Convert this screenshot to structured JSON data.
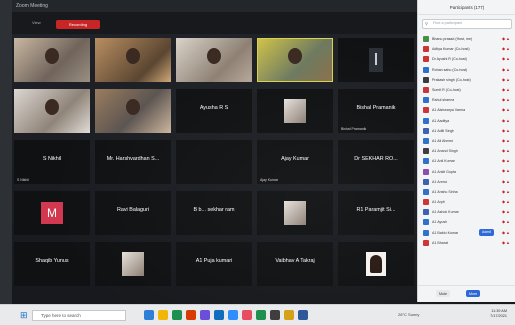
{
  "window": {
    "title": "Zoom Meeting",
    "recording_label": "Recording",
    "view_label": "View"
  },
  "grid": {
    "tiles": [
      {
        "name": "",
        "caption": "",
        "video": "video1"
      },
      {
        "name": "",
        "caption": "",
        "video": "video2"
      },
      {
        "name": "",
        "caption": "",
        "video": "video3"
      },
      {
        "name": "",
        "caption": "",
        "video": "video4",
        "speaking": true
      },
      {
        "name": "",
        "caption": "",
        "thumb": "portrait"
      },
      {
        "name": "",
        "caption": "",
        "video": "video5"
      },
      {
        "name": "",
        "caption": "",
        "video": "video6"
      },
      {
        "name": "Ayusha R S",
        "caption": ""
      },
      {
        "name": "",
        "caption": "",
        "thumb": "photo"
      },
      {
        "name": "Bishal Pramanik",
        "caption": "Bishal Pramanik"
      },
      {
        "name": "S Nikhil",
        "caption": "S Nikhil"
      },
      {
        "name": "Mr. Harshvardhan S...",
        "caption": ""
      },
      {
        "name": "",
        "caption": ""
      },
      {
        "name": "Ajay Kumar",
        "caption": "Ajay Kumar"
      },
      {
        "name": "Dr SEKHAR RO...",
        "caption": ""
      },
      {
        "name": "",
        "caption": "",
        "thumb": "m-avatar"
      },
      {
        "name": "Ravi Balaguri",
        "caption": ""
      },
      {
        "name": "B b... sekhar ram",
        "caption": ""
      },
      {
        "name": "",
        "caption": "",
        "thumb": "photo2"
      },
      {
        "name": "R1 Paramjit Si...",
        "caption": ""
      },
      {
        "name": "Shaqib Yunus",
        "caption": ""
      },
      {
        "name": "",
        "caption": "",
        "thumb": "photo3"
      },
      {
        "name": "A1 Puja kumari",
        "caption": ""
      },
      {
        "name": "Vaibhav A Takraj",
        "caption": ""
      },
      {
        "name": "",
        "caption": "",
        "thumb": "silhouette"
      }
    ]
  },
  "participants_panel": {
    "title": "Participants (177)",
    "search_placeholder": "Find a participant",
    "admit_label": "Admit",
    "mute_all_label": "Mute",
    "more_label": "More",
    "rows": [
      {
        "name": "Bhanu prasad (Host, me)",
        "color": "#4a8c4a"
      },
      {
        "name": "Aditya Kumar (Co-host)",
        "color": "#c33"
      },
      {
        "name": "Dr Ayushi R (Co-host)",
        "color": "#c33"
      },
      {
        "name": "Rohan sahu (Co-host)",
        "color": "#2c6fc9"
      },
      {
        "name": "Prakash singh (Co-host)",
        "color": "#3a3a3a"
      },
      {
        "name": "Sumit R (Co-host)",
        "color": "#c33"
      },
      {
        "name": "Rahul sharma",
        "color": "#2c6fc9"
      },
      {
        "name": "A1 Aishwarya Varma",
        "color": "#c33"
      },
      {
        "name": "A1 Aaditya",
        "color": "#2c6fc9"
      },
      {
        "name": "A1 Aditi Singh",
        "color": "#3a5fb0"
      },
      {
        "name": "A1 Ali Ahmed",
        "color": "#2c6fc9"
      },
      {
        "name": "A1 Anand Singh",
        "color": "#3a3a3a"
      },
      {
        "name": "A1 Anil Kumar",
        "color": "#2c6fc9"
      },
      {
        "name": "A1 Ankit Gupta",
        "color": "#8a4aa8"
      },
      {
        "name": "A1 Anmol",
        "color": "#3a5fb0"
      },
      {
        "name": "A1 Anshu Sinha",
        "color": "#2c6fc9"
      },
      {
        "name": "A1 Arpit",
        "color": "#c33"
      },
      {
        "name": "A1 Ashok Kumar",
        "color": "#3a5fb0"
      },
      {
        "name": "A1 Ayush",
        "color": "#2c6fc9"
      },
      {
        "name": "A1 Bablu Kumar",
        "color": "#2c6fc9"
      },
      {
        "name": "A1 Bharat",
        "color": "#c33"
      }
    ]
  },
  "taskbar": {
    "search_text": "Type here to search",
    "weather": "28°C  Sunny",
    "time": "11:39 AM",
    "date": "7/17/2021",
    "apps": [
      "#2e7fd8",
      "#f2b705",
      "#1e8f4e",
      "#d83b01",
      "#6b4ed8",
      "#0f6cbd",
      "#2d8cff",
      "#e84a5f",
      "#1e8f4e",
      "#3c3c3c",
      "#d4a017",
      "#2b579a"
    ]
  }
}
